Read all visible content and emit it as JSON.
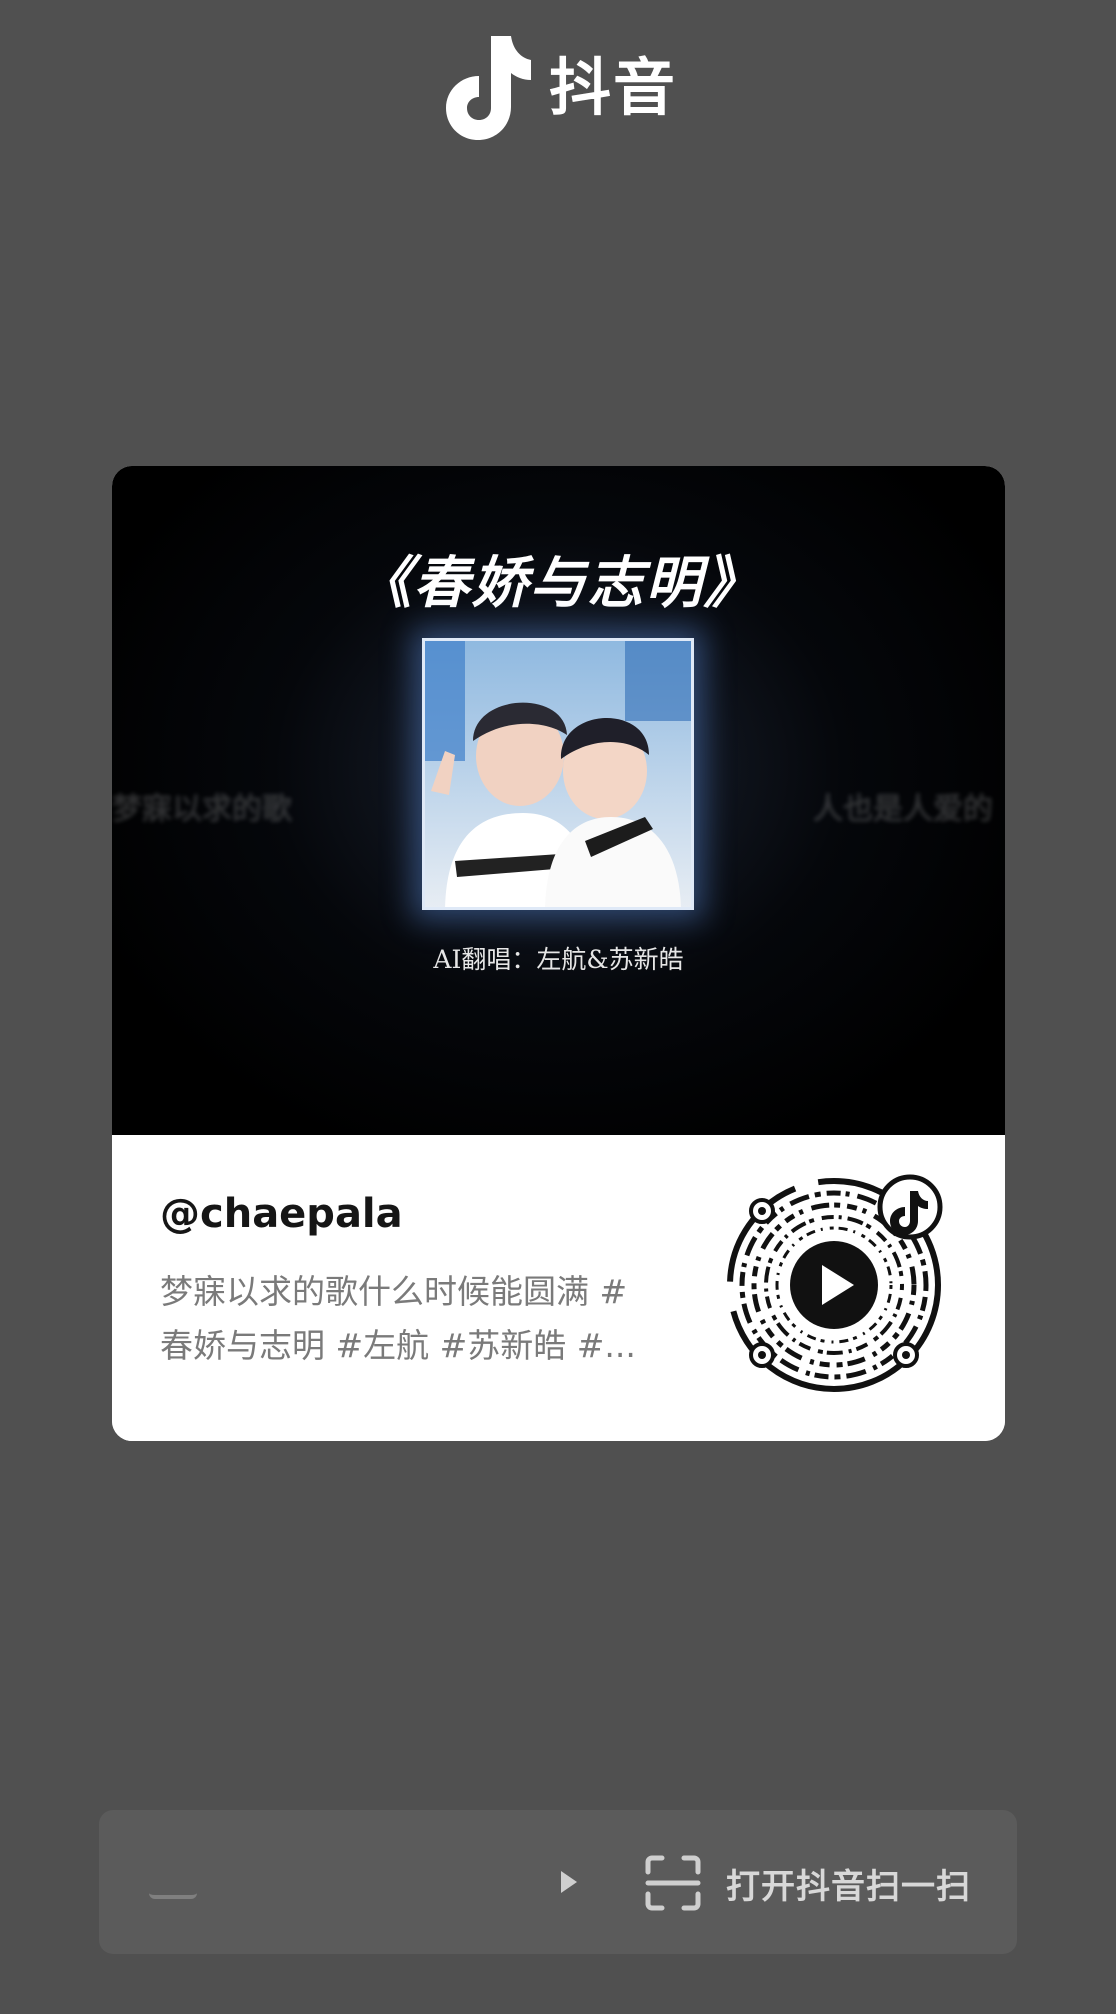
{
  "brand": {
    "name": "抖音",
    "logo_icon": "douyin-note-icon"
  },
  "cover": {
    "title": "《春娇与志明》",
    "credit": "AI翻唱：左航&苏新皓",
    "side_text_left": "梦寐以求的歌",
    "side_text_right": "人也是人爱的"
  },
  "post": {
    "username": "@chaepala",
    "description_line1": "梦寐以求的歌什么时候能圆满 #",
    "description_line2": "春娇与志明 #左航 #苏新皓 #..."
  },
  "qr": {
    "center_icon": "play-icon",
    "badge_icon": "douyin-note-icon"
  },
  "bottom_bar": {
    "left_placeholder": "",
    "arrow_icon": "caret-right-icon",
    "scan_icon": "scan-frame-icon",
    "scan_label": "打开抖音扫一扫"
  },
  "colors": {
    "background": "#505050",
    "card": "#ffffff",
    "accent_cyan": "#25f4ee",
    "accent_red": "#fe2c55"
  }
}
